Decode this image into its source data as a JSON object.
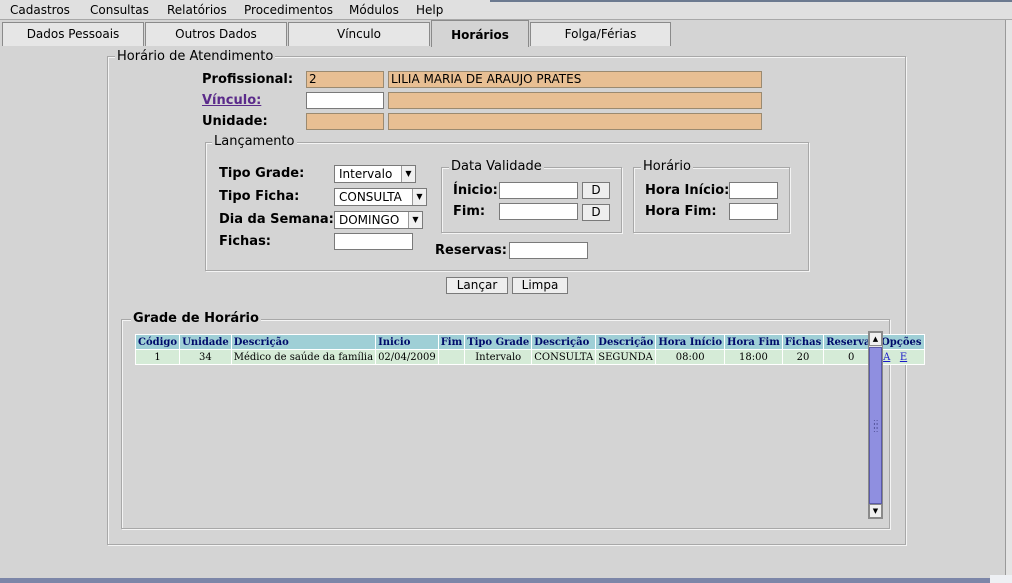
{
  "menu": [
    "Cadastros",
    "Consultas",
    "Relatórios",
    "Procedimentos",
    "Módulos",
    "Help"
  ],
  "tabs": [
    "Dados Pessoais",
    "Outros Dados",
    "Vínculo",
    "Horários",
    "Folga/Férias"
  ],
  "active_tab": "Horários",
  "horario": {
    "legend": "Horário de Atendimento",
    "profissional_label": "Profissional:",
    "profissional_code": "2",
    "profissional_name": "LILIA MARIA DE ARAUJO PRATES",
    "vinculo_label": "Vínculo:",
    "vinculo_code": "",
    "vinculo_desc": "",
    "unidade_label": "Unidade:",
    "unidade_code": "",
    "unidade_desc": ""
  },
  "lancamento": {
    "legend": "Lançamento",
    "tipo_grade_label": "Tipo Grade:",
    "tipo_grade_value": "Intervalo",
    "tipo_ficha_label": "Tipo Ficha:",
    "tipo_ficha_value": "CONSULTA",
    "dia_semana_label": "Dia da Semana:",
    "dia_semana_value": "DOMINGO",
    "fichas_label": "Fichas:",
    "fichas_value": "",
    "reservas_label": "Reservas:",
    "reservas_value": "",
    "data_validade": {
      "legend": "Data Validade",
      "inicio_label": "Ínicio:",
      "inicio_value": "",
      "fim_label": "Fim:",
      "fim_value": "",
      "date_button": "D"
    },
    "horario_box": {
      "legend": "Horário",
      "hora_inicio_label": "Hora Início:",
      "hora_inicio_value": "",
      "hora_fim_label": "Hora Fim:",
      "hora_fim_value": ""
    }
  },
  "buttons": {
    "lancar": "Lançar",
    "limpa": "Limpa"
  },
  "grade": {
    "legend": "Grade de Horário",
    "headers": [
      "Código",
      "Unidade",
      "Descrição",
      "Inicio",
      "Fim",
      "Tipo Grade",
      "Descrição",
      "Descrição",
      "Hora Início",
      "Hora Fim",
      "Fichas",
      "Reservas",
      "Opções"
    ],
    "rows": [
      {
        "codigo": "1",
        "unidade": "34",
        "descricao": "Médico de saúde da família",
        "inicio": "02/04/2009",
        "fim": "",
        "tipo_grade": "Intervalo",
        "descricao2": "CONSULTA",
        "descricao3": "SEGUNDA",
        "hora_inicio": "08:00",
        "hora_fim": "18:00",
        "fichas": "20",
        "reservas": "0",
        "opcao_a": "A",
        "opcao_e": "E"
      }
    ]
  },
  "colors": {
    "readonly_field": "#e8bf93",
    "grid_header": "#9fcfd6",
    "grid_row": "#d5ebd7",
    "scroll_thumb": "#8f8fe0"
  }
}
